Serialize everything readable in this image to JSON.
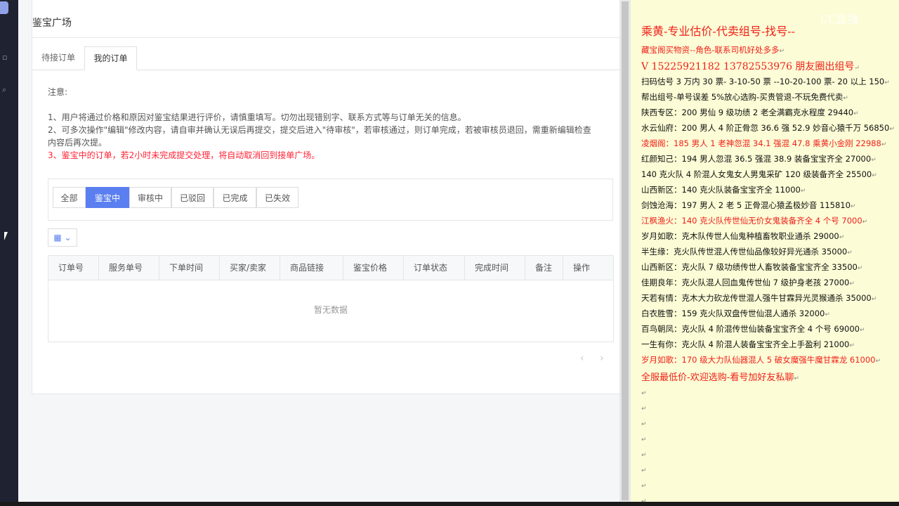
{
  "page": {
    "title": "鉴宝广场",
    "tabs": [
      {
        "label": "待接订单"
      },
      {
        "label": "我的订单"
      }
    ],
    "notice": {
      "heading": "注意:",
      "line1": "1、用户将通过价格和原因对鉴宝结果进行评价，请慎重填写。切勿出现错别字、联系方式等与订单无关的信息。",
      "line2a": "2、可多次操作\"编辑\"修改内容，请自审并确认无误后再提交，提交后进入\"待审核\"，若审核通过，则订单完成，若被审核员退回，需重新编辑检查",
      "line2b": "内容后再次提。",
      "line3": "3、鉴宝中的订单，若2小时未完成提交处理，将自动取消回到接单广场。"
    },
    "filters": [
      {
        "label": "全部"
      },
      {
        "label": "鉴宝中"
      },
      {
        "label": "审核中"
      },
      {
        "label": "已驳回"
      },
      {
        "label": "已完成"
      },
      {
        "label": "已失效"
      }
    ],
    "active_filter": "鉴宝中",
    "table": {
      "columns": [
        "订单号",
        "服务单号",
        "下单时间",
        "买家/卖家",
        "商品链接",
        "鉴宝价格",
        "订单状态",
        "完成时间",
        "备注",
        "操作"
      ],
      "empty_text": "暂无数据"
    },
    "pager": {
      "prev": "‹",
      "next": "›"
    }
  },
  "doc": {
    "title": "乘黄-专业估价-代卖组号-找号--",
    "lines": [
      {
        "text": "藏宝阁买物资--角色-联系司机好处多多",
        "style": "red"
      },
      {
        "text": "V 15225921182    13782553976 朋友圈出组号",
        "style": "red-big"
      },
      {
        "text": "扫码估号 3 万内 30 票- 3-10-50 票  --10-20-100 票- 20 以上 150",
        "style": "black"
      },
      {
        "text": "帮出组号-单号误差 5%放心选购-买贵管退-不玩免费代卖",
        "style": "black"
      },
      {
        "text": "陕西专区：200 男仙 9 级功绩 2 老全满霸克水程度 29440",
        "style": "black"
      },
      {
        "text": "水云仙府：200 男人 4 阶正骨忽 36.6 强 52.9 妙音心猿千万 56850",
        "style": "black"
      },
      {
        "text": "凌烟阁：185 男人 1 老神忽混 34.1 强混 47.8 乘黄小金刚 22988",
        "style": "red"
      },
      {
        "text": "红颜知己：194 男人忽混 36.5 强混 38.9 装备宝宝齐全 27000",
        "style": "black"
      },
      {
        "text": "140 克火队 4 阶混人女鬼女人男鬼采矿 120 级装备齐全 25500",
        "style": "black"
      },
      {
        "text": "山西新区：140 克火队装备宝宝齐全 11000",
        "style": "black"
      },
      {
        "text": "剑蚀沧海：197 男人 2 老 5 正骨混心猿孟极妙音 115810",
        "style": "black"
      },
      {
        "text": "江枫渔火：140 克火队传世仙无价女鬼装备齐全 4 个号 7000",
        "style": "red"
      },
      {
        "text": "岁月如歌：克木队传世人仙鬼种植畜牧职业通杀 29000",
        "style": "black"
      },
      {
        "text": "半生缘：克火队传世混人传世仙品像较好异光通杀 35000",
        "style": "black"
      },
      {
        "text": "山西新区：克火队 7 级功绩传世人畜牧装备宝宝齐全 33500",
        "style": "black"
      },
      {
        "text": "佳期良年：克火队混人回血鬼传世仙 7 级护身老孩 27000",
        "style": "black"
      },
      {
        "text": "天若有情：克木大力砍龙传世混人强牛甘霖异光灵猴通杀 35000",
        "style": "black"
      },
      {
        "text": "白衣胜雪：159 克火队双盘传世仙混人通杀 32000",
        "style": "black"
      },
      {
        "text": "百鸟朝凤：克火队 4 阶混传世仙装备宝宝齐全 4 个号 69000",
        "style": "black"
      },
      {
        "text": "一生有你：克火队 4 阶混人装备宝宝齐全上手盈利 21000",
        "style": "black"
      },
      {
        "text": "岁月如歌：170 级大力队仙器混人 5 破女魔强牛魔甘霖龙 61000",
        "style": "red"
      },
      {
        "text": "全服最低价-欢迎选购-看号加好友私聊",
        "style": "red-mid"
      }
    ],
    "paragraph_mark": "↵"
  },
  "watermark": "CC直播"
}
